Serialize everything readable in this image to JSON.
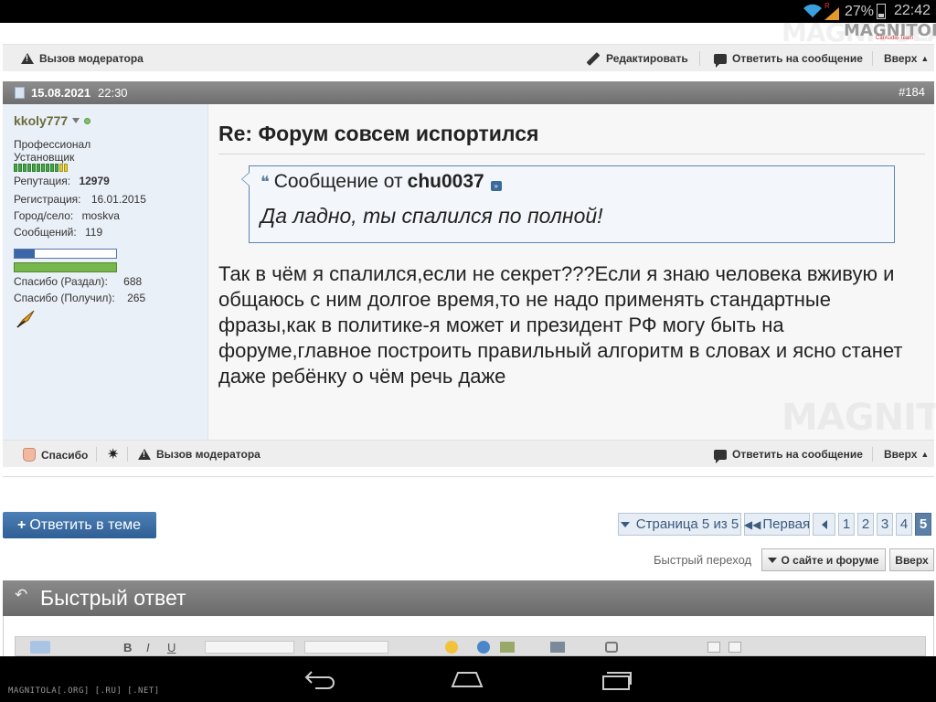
{
  "status_bar": {
    "battery": "27%",
    "time": "22:42"
  },
  "logo": {
    "text": "MAGNITOLA",
    "sub": "CarAudio Team"
  },
  "prev_post_bar": {
    "moderator": "Вызов модератора",
    "edit": "Редактировать",
    "reply": "Ответить на сообщение",
    "up": "Вверх"
  },
  "post": {
    "date": "15.08.2021",
    "time": "22:30",
    "number": "#184",
    "title": "Re: Форум совсем испортился",
    "quote": {
      "prefix": "Сообщение от",
      "author": "chu0037",
      "text": "Да ладно, ты спалился по полной!"
    },
    "body": "Так в чём я спалился,если не секрет???Если я знаю человека вживую и общаюсь с ним долгое время,то не надо применять стандартные фразы,как в политике-я может и президент РФ могу быть на форуме,главное построить правильный алгоритм в словах и ясно станет даже ребёнку о чём речь даже",
    "watermark": "MAGNITOLA"
  },
  "user": {
    "name": "kkoly777",
    "rank1": "Профессионал",
    "rank2": "Установщик",
    "reputation_label": "Репутация:",
    "reputation_value": "12979",
    "registered_label": "Регистрация:",
    "registered_value": "16.01.2015",
    "city_label": "Город/село:",
    "city_value": "moskva",
    "posts_label": "Сообщений:",
    "posts_value": "119",
    "thanks_given_label": "Спасибо (Раздал):",
    "thanks_given_value": "688",
    "thanks_received_label": "Спасибо (Получил):",
    "thanks_received_value": "265"
  },
  "post_bar": {
    "thanks": "Спасибо",
    "moderator": "Вызов модератора",
    "reply": "Ответить на сообщение",
    "up": "Вверх"
  },
  "reply_button": {
    "plus": "+",
    "label": "Ответить в теме"
  },
  "pagination": {
    "page_info": "Страница 5 из 5",
    "first": "Первая",
    "pages": [
      "1",
      "2",
      "3",
      "4",
      "5"
    ],
    "current": "5"
  },
  "quick_nav": {
    "label": "Быстрый переход",
    "select": "О сайте и форуме",
    "up": "Вверх"
  },
  "quick_reply": {
    "title": "Быстрый ответ"
  },
  "navbar": {
    "brand": "MAGNITOLA[.ORG] [.RU] [.NET]"
  }
}
